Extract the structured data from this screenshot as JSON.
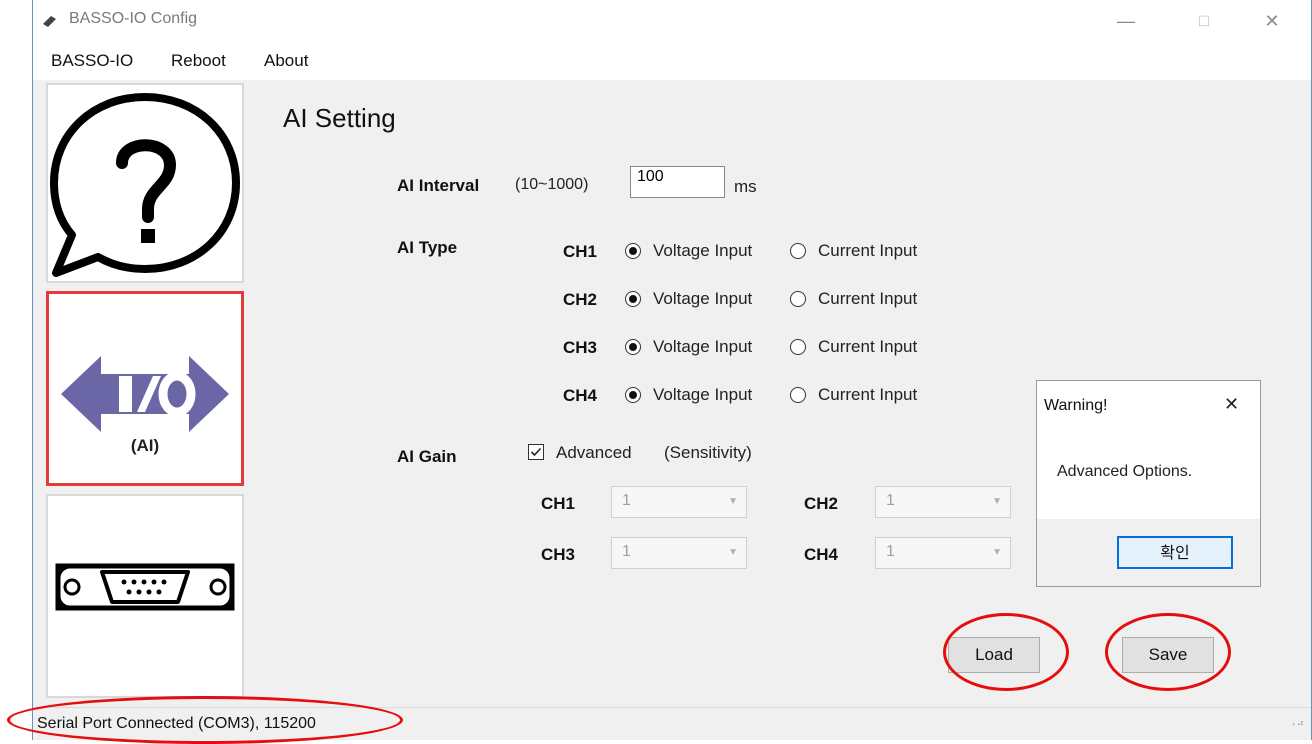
{
  "window": {
    "title": "BASSO-IO Config",
    "minimize": "—",
    "maximize": "☐",
    "close": "✕"
  },
  "menu": [
    "BASSO-IO",
    "Reboot",
    "About"
  ],
  "sidebar": {
    "io_label": "(AI)"
  },
  "content": {
    "title": "AI Setting",
    "interval": {
      "label": "AI Interval",
      "range": "(10~1000)",
      "value": "100",
      "unit": "ms"
    },
    "type": {
      "label": "AI Type",
      "channels": [
        {
          "name": "CH1",
          "voltage": "Voltage Input",
          "current": "Current Input",
          "selected": "voltage"
        },
        {
          "name": "CH2",
          "voltage": "Voltage Input",
          "current": "Current Input",
          "selected": "voltage"
        },
        {
          "name": "CH3",
          "voltage": "Voltage Input",
          "current": "Current Input",
          "selected": "voltage"
        },
        {
          "name": "CH4",
          "voltage": "Voltage Input",
          "current": "Current Input",
          "selected": "voltage"
        }
      ]
    },
    "gain": {
      "label": "AI Gain",
      "advanced_label": "Advanced",
      "advanced_checked": true,
      "sensitivity": "(Sensitivity)",
      "channels": [
        {
          "name": "CH1",
          "value": "1"
        },
        {
          "name": "CH2",
          "value": "1"
        },
        {
          "name": "CH3",
          "value": "1"
        },
        {
          "name": "CH4",
          "value": "1"
        }
      ]
    },
    "load_label": "Load",
    "save_label": "Save"
  },
  "dialog": {
    "title": "Warning!",
    "close": "✕",
    "message": "Advanced Options.",
    "ok_label": "확인"
  },
  "status": {
    "text": "Serial Port Connected (COM3), 115200"
  },
  "colors": {
    "highlight": "#e50d0d",
    "io_purple": "#6b67a6"
  }
}
